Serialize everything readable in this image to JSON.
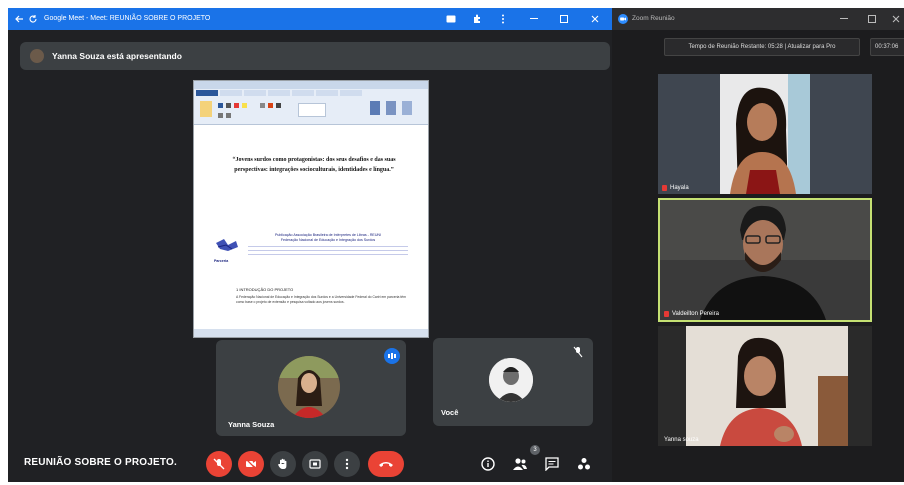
{
  "meet": {
    "window_title": "Google Meet - Meet: REUNIÃO SOBRE O PROJETO",
    "presenting_text": "Yanna Souza está apresentando",
    "meeting_name": "REUNIÃO SOBRE O PROJETO.",
    "participants": [
      {
        "name": "Yanna Souza",
        "speaking": true
      },
      {
        "name": "Você",
        "muted": true
      }
    ],
    "participants_count": "3",
    "document": {
      "quote": "“Jovens surdos como protagonistas: dos seus desafios e das suas perspectivas: integrações socioculturais, identidades e língua.”",
      "org_lines": [
        "Publicação Associação Brasileira de Intérpretes de Libras - REUNI",
        "Federação Nacional de Educação e Integração dos Surdos"
      ],
      "logo_caption": "Parceria",
      "section": "1 INTRODUÇÃO DO PROJETO",
      "paragraph": "A Federação Nacional de Educação e Integração dos Surdos e a Universidade Federal do Cariri em parceria têm como base o projeto de extensão e pesquisa voltado aos jovens surdos."
    },
    "colors": {
      "bg": "#202124",
      "tile": "#3c4043",
      "accent": "#1a73e8",
      "danger": "#ea4335"
    }
  },
  "zoom": {
    "window_title": "Zoom Reunião",
    "timer_text": "Tempo de Reunião Restante: 05:28 | Atualizar para Pro",
    "clock": "00:37:06",
    "participants": [
      {
        "name": "Hayala"
      },
      {
        "name": "Valdeilton Pereira",
        "active": true
      },
      {
        "name": "Yanna souza"
      }
    ],
    "colors": {
      "active_border": "#c5e173"
    }
  },
  "icons": [
    "back-arrow-icon",
    "reload-icon",
    "cast-icon",
    "extension-icon",
    "more-vert-icon",
    "minimize-icon",
    "maximize-icon",
    "close-icon",
    "mic-off-icon",
    "camera-off-icon",
    "raise-hand-icon",
    "present-icon",
    "more-options-icon",
    "hangup-icon",
    "info-icon",
    "people-icon",
    "chat-icon",
    "activities-icon"
  ]
}
